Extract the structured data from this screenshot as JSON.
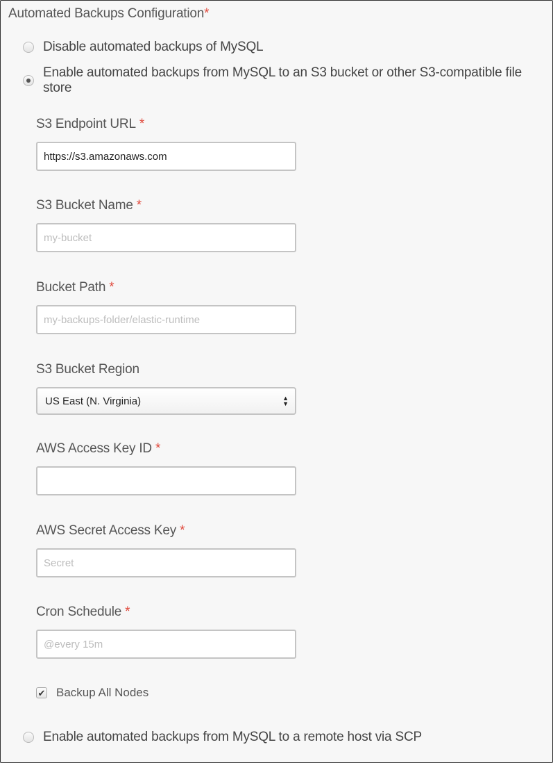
{
  "section": {
    "title": "Automated Backups Configuration",
    "required_mark": "*"
  },
  "options": {
    "disable": {
      "label": "Disable automated backups of MySQL",
      "checked": false
    },
    "s3": {
      "label": "Enable automated backups from MySQL to an S3 bucket or other S3-compatible file store",
      "checked": true
    },
    "scp": {
      "label": "Enable automated backups from MySQL to a remote host via SCP",
      "checked": false
    }
  },
  "fields": {
    "endpoint": {
      "label": "S3 Endpoint URL",
      "required": "*",
      "value": "https://s3.amazonaws.com",
      "placeholder": ""
    },
    "bucket_name": {
      "label": "S3 Bucket Name",
      "required": "*",
      "value": "",
      "placeholder": "my-bucket"
    },
    "bucket_path": {
      "label": "Bucket Path",
      "required": "*",
      "value": "",
      "placeholder": "my-backups-folder/elastic-runtime"
    },
    "region": {
      "label": "S3 Bucket Region",
      "selected": "US East (N. Virginia)"
    },
    "access_key": {
      "label": "AWS Access Key ID",
      "required": "*",
      "value": "",
      "placeholder": ""
    },
    "secret_key": {
      "label": "AWS Secret Access Key",
      "required": "*",
      "value": "",
      "placeholder": "Secret"
    },
    "cron": {
      "label": "Cron Schedule",
      "required": "*",
      "value": "",
      "placeholder": "@every 15m"
    }
  },
  "backup_all_nodes": {
    "label": "Backup All Nodes",
    "checked": true,
    "check_glyph": "✔"
  },
  "icons": {
    "select_up": "▲",
    "select_down": "▼"
  }
}
